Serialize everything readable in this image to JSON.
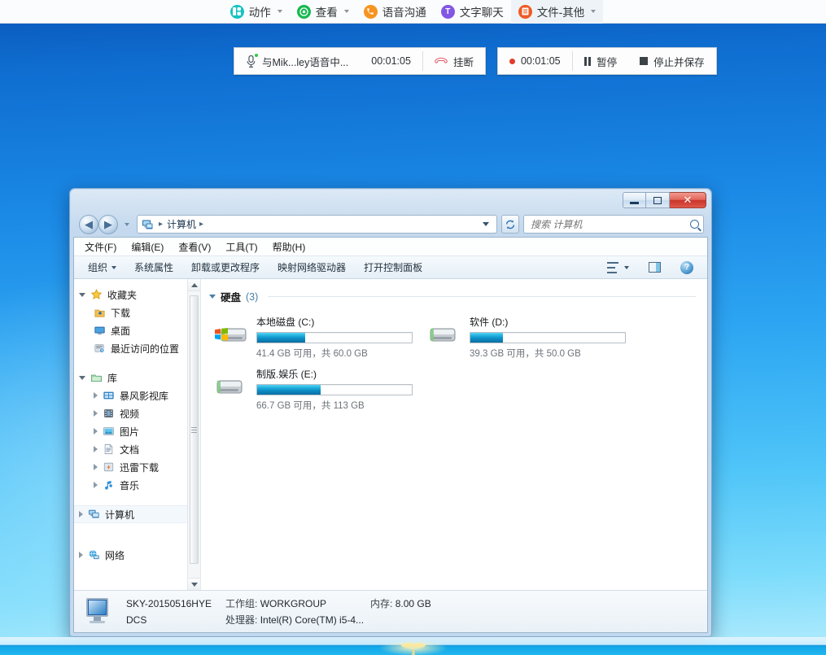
{
  "topbar": {
    "items": [
      {
        "label": "动作",
        "icon": "grid-icon",
        "has_caret": true,
        "active": false
      },
      {
        "label": "查看",
        "icon": "target-icon",
        "has_caret": true,
        "active": false
      },
      {
        "label": "语音沟通",
        "icon": "phone-icon",
        "has_caret": false,
        "active": false
      },
      {
        "label": "文字聊天",
        "icon": "text-chat-icon",
        "has_caret": false,
        "active": false
      },
      {
        "label": "文件-其他",
        "icon": "file-icon",
        "has_caret": true,
        "active": true
      }
    ]
  },
  "call_bar": {
    "title": "与Mik...ley语音中...",
    "duration": "00:01:05",
    "hangup_label": "挂断",
    "recording": {
      "timer": "00:01:05",
      "pause_label": "暂停",
      "stop_label": "停止并保存"
    }
  },
  "explorer": {
    "window_buttons": {
      "minimize": "",
      "maximize": "",
      "close": "✕"
    },
    "address": {
      "crumb_root": "计算机",
      "separator": "▸"
    },
    "search": {
      "placeholder": "搜索 计算机",
      "value": ""
    },
    "menubar": [
      "文件(F)",
      "编辑(E)",
      "查看(V)",
      "工具(T)",
      "帮助(H)"
    ],
    "commandbar": {
      "organize": "组织",
      "items": [
        "系统属性",
        "卸载或更改程序",
        "映射网络驱动器",
        "打开控制面板"
      ]
    },
    "navpane": {
      "sections": [
        {
          "header": {
            "label": "收藏夹",
            "icon": "star-icon",
            "expanded": true
          },
          "items": [
            {
              "label": "下载",
              "icon": "downloads-icon",
              "expandable": false
            },
            {
              "label": "桌面",
              "icon": "desktop-icon",
              "expandable": false
            },
            {
              "label": "最近访问的位置",
              "icon": "recent-places-icon",
              "expandable": false
            }
          ]
        },
        {
          "header": {
            "label": "库",
            "icon": "library-icon",
            "expanded": true
          },
          "items": [
            {
              "label": "暴风影视库",
              "icon": "video-library-icon",
              "expandable": true
            },
            {
              "label": "视频",
              "icon": "videos-icon",
              "expandable": true
            },
            {
              "label": "图片",
              "icon": "pictures-icon",
              "expandable": true
            },
            {
              "label": "文档",
              "icon": "documents-icon",
              "expandable": true
            },
            {
              "label": "迅雷下载",
              "icon": "thunder-download-icon",
              "expandable": true
            },
            {
              "label": "音乐",
              "icon": "music-icon",
              "expandable": true
            }
          ]
        },
        {
          "header": {
            "label": "计算机",
            "icon": "computer-icon",
            "expanded": false,
            "selected": true
          },
          "items": []
        },
        {
          "header": {
            "label": "网络",
            "icon": "network-icon",
            "expanded": false
          },
          "items": []
        }
      ]
    },
    "content": {
      "group_title": "硬盘",
      "group_count": "(3)",
      "drives": [
        {
          "name": "本地磁盘 (C:)",
          "free_total": "41.4 GB 可用，共 60.0 GB",
          "used_percent": 31,
          "icon": "system-drive-icon"
        },
        {
          "name": "软件 (D:)",
          "free_total": "39.3 GB 可用，共 50.0 GB",
          "used_percent": 21,
          "icon": "drive-icon"
        },
        {
          "name": "制版.娱乐 (E:)",
          "free_total": "66.7 GB 可用，共 113 GB",
          "used_percent": 41,
          "icon": "drive-icon"
        }
      ]
    },
    "statusbar": {
      "computer_name": "SKY-20150516HYE",
      "domain": "DCS",
      "workgroup_label": "工作组:",
      "workgroup_value": "WORKGROUP",
      "processor_label": "处理器:",
      "processor_value": "Intel(R) Core(TM) i5-4...",
      "memory_label": "内存:",
      "memory_value": "8.00 GB"
    }
  },
  "colors": {
    "accent_blue": "#0d8dc4",
    "close_red": "#c8362a",
    "link_blue": "#16537e",
    "desktop_top": "#0a56b8",
    "desktop_bottom": "#b5ecfd"
  }
}
